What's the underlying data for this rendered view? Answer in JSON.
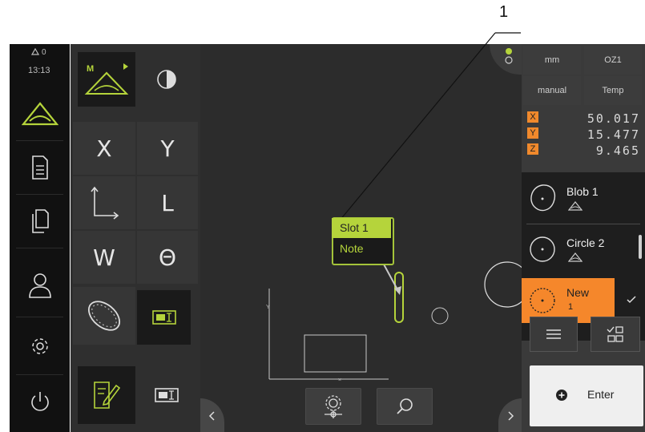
{
  "annotation": {
    "number": "1"
  },
  "status": {
    "counter": "0",
    "time": "13:13"
  },
  "units": {
    "length": "mm",
    "origin": "OZ1",
    "mode": "manual",
    "temp": "Temp"
  },
  "coords": [
    {
      "axis": "X",
      "value": "50.017"
    },
    {
      "axis": "Y",
      "value": "15.477"
    },
    {
      "axis": "Z",
      "value": "9.465"
    }
  ],
  "tools": {
    "x": "X",
    "y": "Y",
    "l": "L",
    "w": "W",
    "theta": "Θ"
  },
  "features": [
    {
      "name": "Blob 1"
    },
    {
      "name": "Circle 2"
    },
    {
      "name": "New",
      "sub": "1"
    }
  ],
  "callout": {
    "title": "Slot 1",
    "note": "Note"
  },
  "enter_label": "Enter",
  "colors": {
    "accent_green": "#b5d43b",
    "accent_orange": "#f5872b",
    "panel_dark": "#1e1e1e"
  }
}
